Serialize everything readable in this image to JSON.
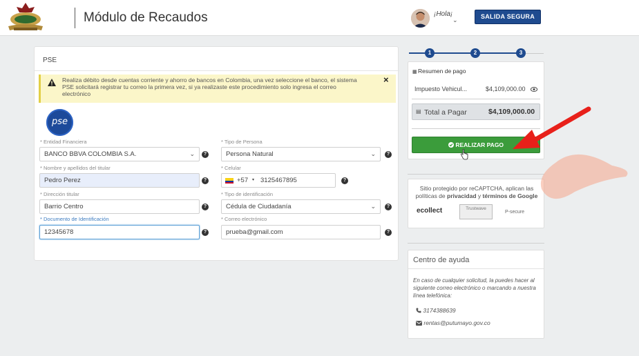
{
  "header": {
    "title": "Módulo de Recaudos",
    "greeting": "¡Hola¡",
    "logout_label": "SALIDA SEGURA",
    "logo_icon": "putumayo-logo"
  },
  "form": {
    "tab_label": "PSE",
    "alert": {
      "text": "Realiza débito desde cuentas corriente y ahorro de bancos en Colombia, una vez seleccione el banco, el sistema PSE solicitará registrar tu correo la primera vez, si ya realizaste este procedimiento solo ingresa el correo electrónico",
      "close": "×"
    },
    "pse_logo_text": "pse",
    "fields": {
      "entidad": {
        "label": "* Entidad Financiera",
        "value": "BANCO BBVA COLOMBIA S.A."
      },
      "tipo_persona": {
        "label": "* Tipo de Persona",
        "value": "Persona Natural"
      },
      "nombre": {
        "label": "* Nombre y apellidos del titular",
        "value": "Pedro Perez"
      },
      "celular": {
        "label": "* Celular",
        "prefix": "+57",
        "value": "3125467895"
      },
      "direccion": {
        "label": "* Dirección titular",
        "value": "Barrio Centro"
      },
      "tipo_id": {
        "label": "* Tipo de identificación",
        "value": "Cédula de Ciudadanía"
      },
      "documento": {
        "label": "* Documento de Identificación",
        "value": "12345678"
      },
      "correo": {
        "label": "* Correo electrónico",
        "value": "prueba@gmail.com"
      }
    },
    "help_glyph": "?"
  },
  "stepper": {
    "steps": [
      "1",
      "2",
      "3"
    ]
  },
  "summary": {
    "title": "Resumen de pago",
    "item_label": "Impuesto Vehicul...",
    "item_value": "$4,109,000.00",
    "total_label": "Total a Pagar",
    "total_value": "$4,109,000.00",
    "pay_label": "REALIZAR PAGO"
  },
  "recaptcha": {
    "line1": "Sitio protegido por reCAPTCHA, aplican las",
    "line2_pre": "políticas de ",
    "privacy": "privacidad",
    "line2_mid": " y ",
    "terms": "términos de Google",
    "partners": [
      "ecollect",
      "Trustwave",
      "P-secure"
    ]
  },
  "help_center": {
    "title": "Centro de ayuda",
    "text": "En caso de cualquier solicitud, la puedes hacer al siguiente correo electrónico o marcando a nuestra línea telefónica:",
    "phone": "3174388639",
    "email": "rentas@putumayo.gov.co"
  },
  "colors": {
    "primary": "#1f4b8f",
    "pay_green": "#3b9c3b",
    "alert_bg": "#fbf6c9",
    "arrow_red": "#e8201a"
  }
}
